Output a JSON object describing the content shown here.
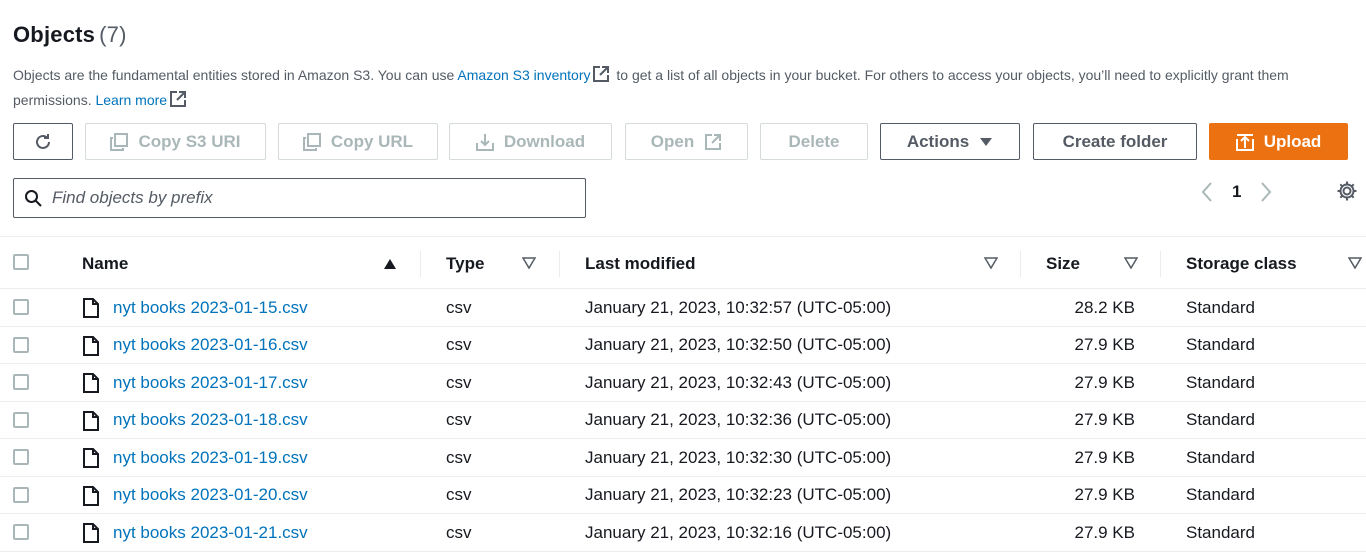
{
  "header": {
    "title": "Objects",
    "count": "(7)"
  },
  "description": {
    "part1": "Objects are the fundamental entities stored in Amazon S3. You can use ",
    "inventory_link": "Amazon S3 inventory",
    "part2": " to get a list of all objects in your bucket. For others to access your objects, you’ll need to explicitly grant them permissions. ",
    "learn_more": "Learn more"
  },
  "toolbar": {
    "copy_s3_uri": "Copy S3 URI",
    "copy_url": "Copy URL",
    "download": "Download",
    "open": "Open",
    "delete": "Delete",
    "actions": "Actions",
    "create_folder": "Create folder",
    "upload": "Upload"
  },
  "search": {
    "placeholder": "Find objects by prefix"
  },
  "pagination": {
    "current_page": "1"
  },
  "table": {
    "columns": {
      "name": "Name",
      "type": "Type",
      "last_modified": "Last modified",
      "size": "Size",
      "storage_class": "Storage class"
    },
    "rows": [
      {
        "name": "nyt books 2023-01-15.csv",
        "type": "csv",
        "last_modified": "January 21, 2023, 10:32:57 (UTC-05:00)",
        "size": "28.2 KB",
        "storage_class": "Standard"
      },
      {
        "name": "nyt books 2023-01-16.csv",
        "type": "csv",
        "last_modified": "January 21, 2023, 10:32:50 (UTC-05:00)",
        "size": "27.9 KB",
        "storage_class": "Standard"
      },
      {
        "name": "nyt books 2023-01-17.csv",
        "type": "csv",
        "last_modified": "January 21, 2023, 10:32:43 (UTC-05:00)",
        "size": "27.9 KB",
        "storage_class": "Standard"
      },
      {
        "name": "nyt books 2023-01-18.csv",
        "type": "csv",
        "last_modified": "January 21, 2023, 10:32:36 (UTC-05:00)",
        "size": "27.9 KB",
        "storage_class": "Standard"
      },
      {
        "name": "nyt books 2023-01-19.csv",
        "type": "csv",
        "last_modified": "January 21, 2023, 10:32:30 (UTC-05:00)",
        "size": "27.9 KB",
        "storage_class": "Standard"
      },
      {
        "name": "nyt books 2023-01-20.csv",
        "type": "csv",
        "last_modified": "January 21, 2023, 10:32:23 (UTC-05:00)",
        "size": "27.9 KB",
        "storage_class": "Standard"
      },
      {
        "name": "nyt books 2023-01-21.csv",
        "type": "csv",
        "last_modified": "January 21, 2023, 10:32:16 (UTC-05:00)",
        "size": "27.9 KB",
        "storage_class": "Standard"
      }
    ]
  },
  "colors": {
    "link": "#0073bb",
    "primary": "#ec7211",
    "disabled": "#aab7b8",
    "text": "#16191f"
  },
  "icons": [
    "refresh-icon",
    "copy-icon",
    "download-icon",
    "external-link-icon",
    "caret-down-icon",
    "upload-icon",
    "search-icon",
    "chevron-left-icon",
    "chevron-right-icon",
    "gear-icon",
    "file-icon",
    "sort-ascending-icon",
    "sort-icon"
  ]
}
